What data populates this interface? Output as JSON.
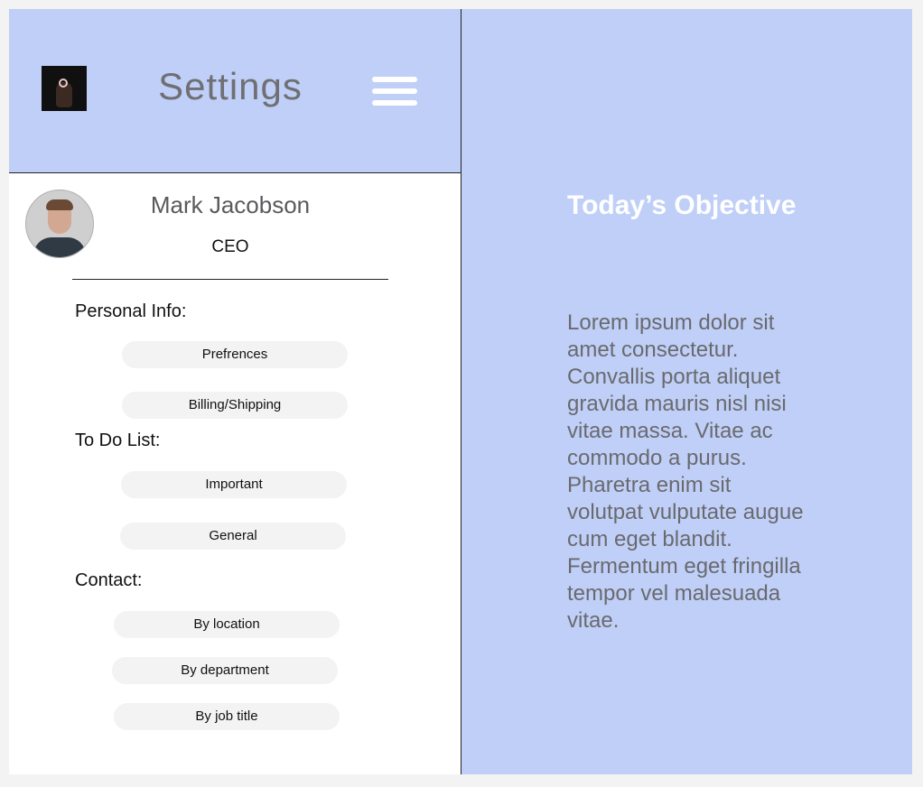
{
  "header": {
    "title": "Settings",
    "logo_icon": "ring-hand-logo-icon",
    "menu_icon": "hamburger-menu-icon",
    "background_color": "#bfcff7"
  },
  "profile": {
    "name": "Mark Jacobson",
    "role": "CEO",
    "avatar_icon": "profile-photo"
  },
  "sections": {
    "personal_info": {
      "label": "Personal Info:",
      "items": [
        "Prefrences",
        "Billing/Shipping"
      ]
    },
    "todo": {
      "label": "To Do List:",
      "items": [
        "Important",
        "General"
      ]
    },
    "contact": {
      "label": "Contact:",
      "items": [
        "By location",
        "By department",
        "By job title"
      ]
    }
  },
  "objective": {
    "title": "Today’s Objective",
    "body": "Lorem ipsum dolor sit amet consectetur. Convallis porta aliquet gravida mauris nisl nisi vitae massa. Vitae ac commodo a purus. Pharetra enim sit volutpat vulputate augue cum eget blandit. Fermentum eget fringilla tempor vel malesuada vitae."
  },
  "colors": {
    "accent": "#bfcff7",
    "pill": "#f3f3f3"
  }
}
